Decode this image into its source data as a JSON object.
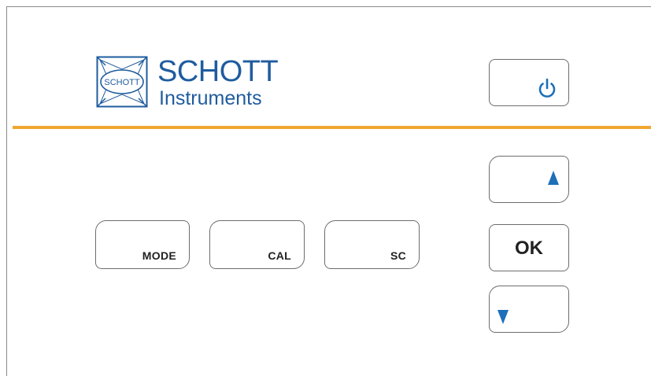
{
  "brand": {
    "emblem_text": "SCHOTT",
    "name": "SCHOTT",
    "subtitle": "Instruments",
    "color": "#1f5c9e"
  },
  "accent_color": "#f0a731",
  "keys": {
    "power": {
      "icon": "power-icon"
    },
    "mode": {
      "label": "MODE"
    },
    "cal": {
      "label": "CAL"
    },
    "sc": {
      "label": "SC"
    },
    "up": {
      "icon": "arrow-up-icon"
    },
    "ok": {
      "label": "OK"
    },
    "down": {
      "icon": "arrow-down-icon"
    }
  }
}
